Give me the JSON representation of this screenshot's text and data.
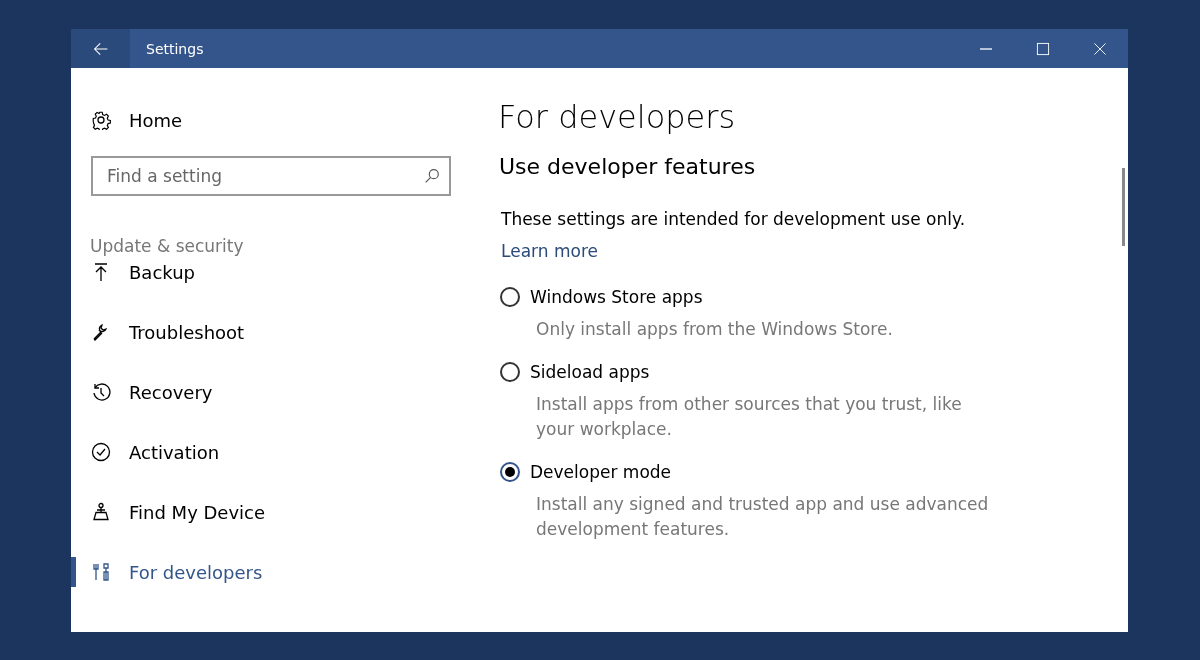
{
  "window": {
    "title": "Settings"
  },
  "sidebar": {
    "home": "Home",
    "search": {
      "placeholder": "Find a setting"
    },
    "section": "Update & security",
    "items": [
      {
        "label": "Backup",
        "selected": false
      },
      {
        "label": "Troubleshoot",
        "selected": false
      },
      {
        "label": "Recovery",
        "selected": false
      },
      {
        "label": "Activation",
        "selected": false
      },
      {
        "label": "Find My Device",
        "selected": false
      },
      {
        "label": "For developers",
        "selected": true
      }
    ]
  },
  "content": {
    "title": "For developers",
    "subtitle": "Use developer features",
    "intro": "These settings are intended for development use only.",
    "link": "Learn more",
    "options": [
      {
        "label": "Windows Store apps",
        "description": "Only install apps from the Windows Store.",
        "selected": false
      },
      {
        "label": "Sideload apps",
        "description": "Install apps from other sources that you trust, like your workplace.",
        "selected": false
      },
      {
        "label": "Developer mode",
        "description": "Install any signed and trusted app and use advanced development features.",
        "selected": true
      }
    ]
  }
}
